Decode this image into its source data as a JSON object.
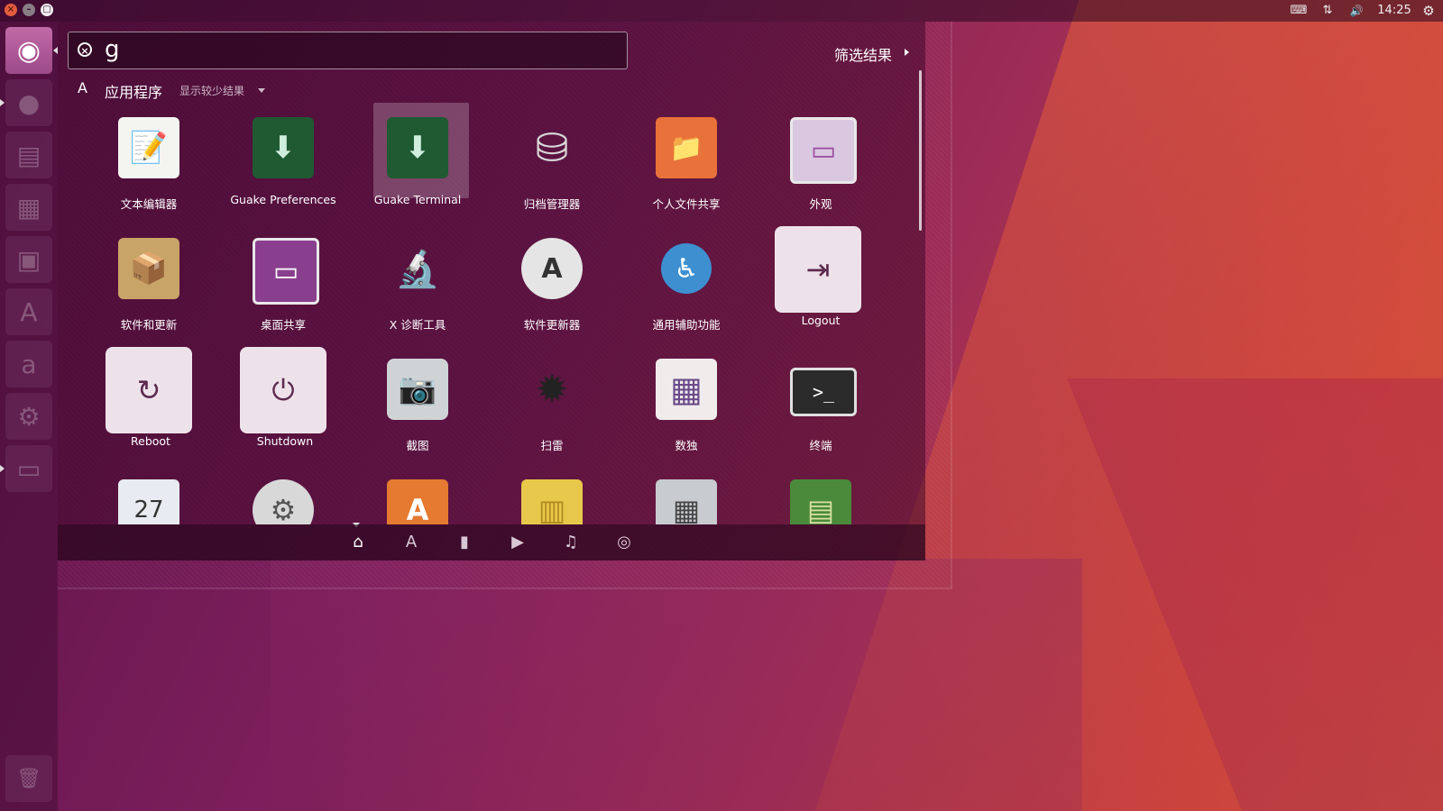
{
  "window_buttons": {
    "close": "×",
    "minimize": "–",
    "maximize": "▢"
  },
  "tray": {
    "keyboard_icon": "⌨",
    "network_icon": "⇅",
    "volume_icon": "🔊",
    "time": "14:25",
    "settings_icon": "⚙"
  },
  "launcher": {
    "items": [
      {
        "name": "ubuntu-dash",
        "glyph": "◉"
      },
      {
        "name": "firefox",
        "glyph": "●"
      },
      {
        "name": "writer",
        "glyph": "▤"
      },
      {
        "name": "calc",
        "glyph": "▦"
      },
      {
        "name": "impress",
        "glyph": "▣"
      },
      {
        "name": "software-center",
        "glyph": "A"
      },
      {
        "name": "amazon",
        "glyph": "a"
      },
      {
        "name": "system-settings",
        "glyph": "⚙"
      },
      {
        "name": "files",
        "glyph": "▭"
      },
      {
        "name": "trash",
        "glyph": "🗑"
      }
    ]
  },
  "search": {
    "value": "g",
    "clear_icon": "×"
  },
  "filter": {
    "label": "筛选结果"
  },
  "category": {
    "icon": "A",
    "label": "应用程序",
    "more_label": "显示较少结果"
  },
  "apps": [
    {
      "label": "文本编辑器",
      "glyph": "📝",
      "color": "#f2f2ee"
    },
    {
      "label": "Guake Preferences",
      "glyph": "⬇",
      "color": "#1f5a32"
    },
    {
      "label": "Guake Terminal",
      "glyph": "⬇",
      "color": "#1f5a32"
    },
    {
      "label": "归档管理器",
      "glyph": "⛁",
      "color": "#d9d9d9"
    },
    {
      "label": "个人文件共享",
      "glyph": "📁",
      "color": "#e9713a"
    },
    {
      "label": "外观",
      "glyph": "▭",
      "color": "#d9c8e0"
    },
    {
      "label": "软件和更新",
      "glyph": "📦",
      "color": "#c8a468"
    },
    {
      "label": "桌面共享",
      "glyph": "▭",
      "color": "#8a3f8e"
    },
    {
      "label": "X 诊断工具",
      "glyph": "🔬",
      "color": "#3c6aa8"
    },
    {
      "label": "软件更新器",
      "glyph": "A",
      "color": "#e5e5e5"
    },
    {
      "label": "通用辅助功能",
      "glyph": "♿",
      "color": "#3d8fd0"
    },
    {
      "label": "Logout",
      "glyph": "⇥"
    },
    {
      "label": "Reboot",
      "glyph": "↻"
    },
    {
      "label": "Shutdown",
      "glyph": "⏻"
    },
    {
      "label": "截图",
      "glyph": "📷",
      "color": "#cfd3d6"
    },
    {
      "label": "扫雷",
      "glyph": "✹",
      "color": "#333333"
    },
    {
      "label": "数独",
      "glyph": "▦",
      "color": "#f0ecec"
    },
    {
      "label": "终端",
      "glyph": ">_",
      "color": "#2b2b2b"
    },
    {
      "label": "",
      "glyph": "27",
      "color": "#e8ecf2"
    },
    {
      "label": "",
      "glyph": "⚙",
      "color": "#d8d8d8"
    },
    {
      "label": "",
      "glyph": "A",
      "color": "#e57a30"
    },
    {
      "label": "",
      "glyph": "▥",
      "color": "#e8c84a"
    },
    {
      "label": "",
      "glyph": "▦",
      "color": "#c8cbd0"
    },
    {
      "label": "",
      "glyph": "▤",
      "color": "#4a8a3a"
    }
  ],
  "lenses": [
    {
      "name": "home",
      "glyph": "⌂"
    },
    {
      "name": "applications",
      "glyph": "A"
    },
    {
      "name": "files",
      "glyph": "▮"
    },
    {
      "name": "video",
      "glyph": "▶"
    },
    {
      "name": "music",
      "glyph": "♫"
    },
    {
      "name": "photos",
      "glyph": "◎"
    }
  ]
}
